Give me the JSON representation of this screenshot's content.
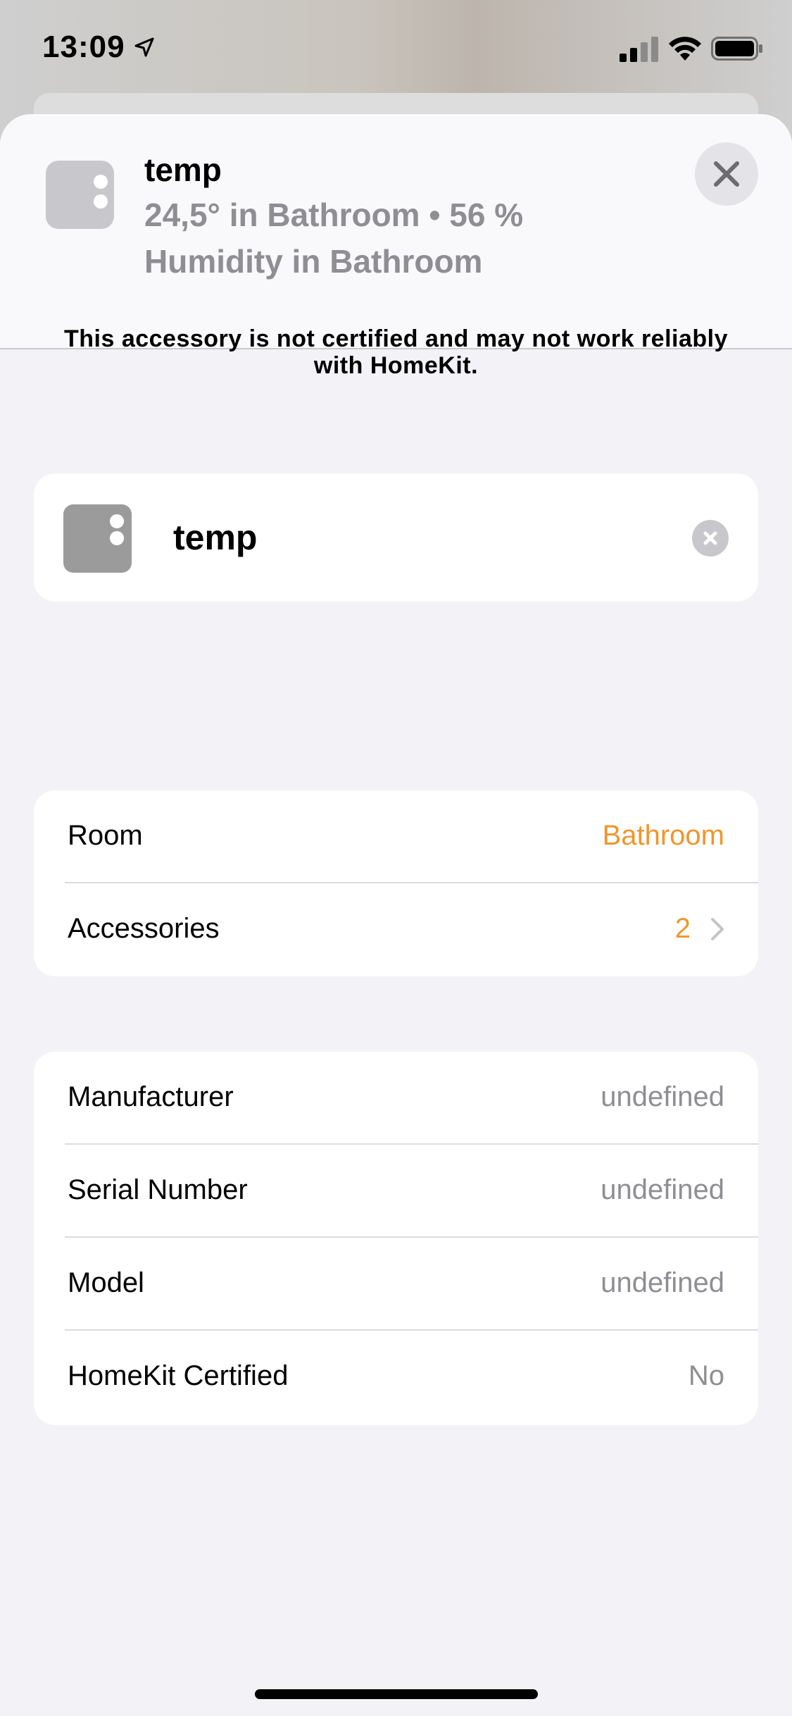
{
  "status_bar": {
    "time": "13:09"
  },
  "header": {
    "title": "temp",
    "subtitle": "24,5° in Bathroom • 56 % Humidity in Bathroom"
  },
  "notice": "This accessory is not certified and may not work reliably with HomeKit.",
  "name_field": {
    "value": "temp"
  },
  "room_section": {
    "rows": [
      {
        "label": "Room",
        "value": "Bathroom"
      },
      {
        "label": "Accessories",
        "value": "2"
      }
    ]
  },
  "info_section": {
    "rows": [
      {
        "label": "Manufacturer",
        "value": "undefined"
      },
      {
        "label": "Serial Number",
        "value": "undefined"
      },
      {
        "label": "Model",
        "value": "undefined"
      },
      {
        "label": "HomeKit Certified",
        "value": "No"
      }
    ]
  },
  "colors": {
    "accent": "#f0962c",
    "secondary_text": "#8e8e93",
    "background": "#f2f2f7"
  },
  "icons": [
    "location-arrow-icon",
    "signal-icon",
    "wifi-icon",
    "battery-icon",
    "accessory-icon",
    "close-icon",
    "clear-icon",
    "chevron-right-icon"
  ]
}
